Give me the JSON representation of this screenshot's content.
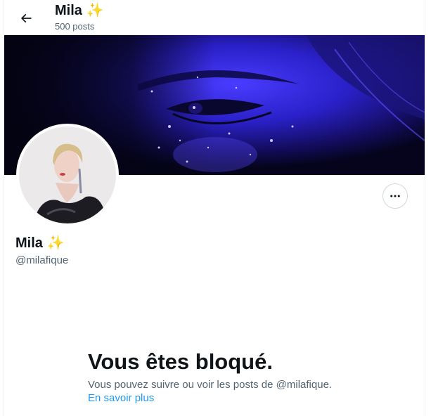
{
  "header": {
    "title": "Mila",
    "title_emoji": "✨",
    "post_count": "500 posts"
  },
  "profile": {
    "name": "Mila",
    "name_emoji": "✨",
    "handle": "@milafique"
  },
  "blocked": {
    "title": "Vous êtes bloqué.",
    "description": "Vous pouvez suivre ou voir les posts de @milafique.",
    "link_label": "En savoir plus"
  },
  "icons": {
    "back": "arrow-left-icon",
    "more": "more-horizontal-icon",
    "sparkle": "sparkles-emoji"
  },
  "colors": {
    "text_primary": "#0f1419",
    "text_secondary": "#536471",
    "link": "#1d9bf0",
    "border": "#cfd9de",
    "banner_blue": "#2a20d8",
    "sparkle": "#f4b400"
  }
}
